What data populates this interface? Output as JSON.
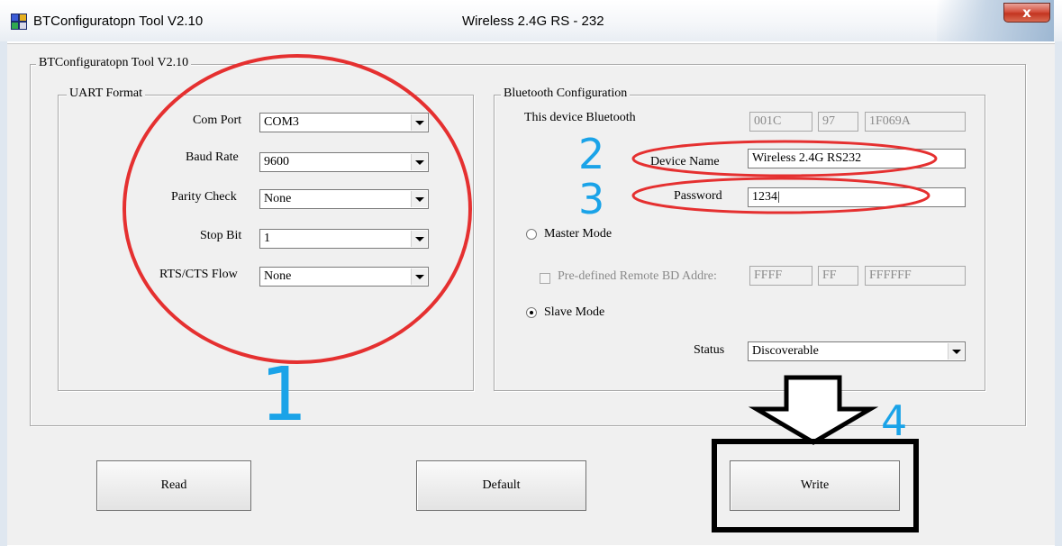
{
  "window": {
    "title": "BTConfiguratopn Tool V2.10",
    "center_title": "Wireless 2.4G RS - 232",
    "close_label": "x"
  },
  "main_group": {
    "legend": "BTConfiguratopn Tool V2.10"
  },
  "uart": {
    "legend": "UART Format",
    "fields": [
      {
        "label": "Com Port",
        "value": "COM3"
      },
      {
        "label": "Baud Rate",
        "value": "9600"
      },
      {
        "label": "Parity Check",
        "value": "None"
      },
      {
        "label": "Stop Bit",
        "value": "1"
      },
      {
        "label": "RTS/CTS Flow",
        "value": "None"
      }
    ]
  },
  "bluetooth": {
    "legend": "Bluetooth Configuration",
    "this_device_label": "This device Bluetooth",
    "address": [
      "001C",
      "97",
      "1F069A"
    ],
    "device_name_label": "Device Name",
    "device_name_value": "Wireless 2.4G RS232",
    "password_label": "Password",
    "password_value": "1234|",
    "master_mode_label": "Master Mode",
    "predefined_label": "Pre-defined Remote BD Addre:",
    "remote_address": [
      "FFFF",
      "FF",
      "FFFFFF"
    ],
    "slave_mode_label": "Slave Mode",
    "status_label": "Status",
    "status_value": "Discoverable"
  },
  "buttons": {
    "read": "Read",
    "default": "Default",
    "write": "Write"
  },
  "annotations": {
    "step1": "1",
    "step2": "2",
    "step3": "3",
    "step4": "4"
  },
  "colors": {
    "annotation_red": "#e53030",
    "annotation_blue": "#1aa3e8",
    "annotation_black": "#000000"
  }
}
